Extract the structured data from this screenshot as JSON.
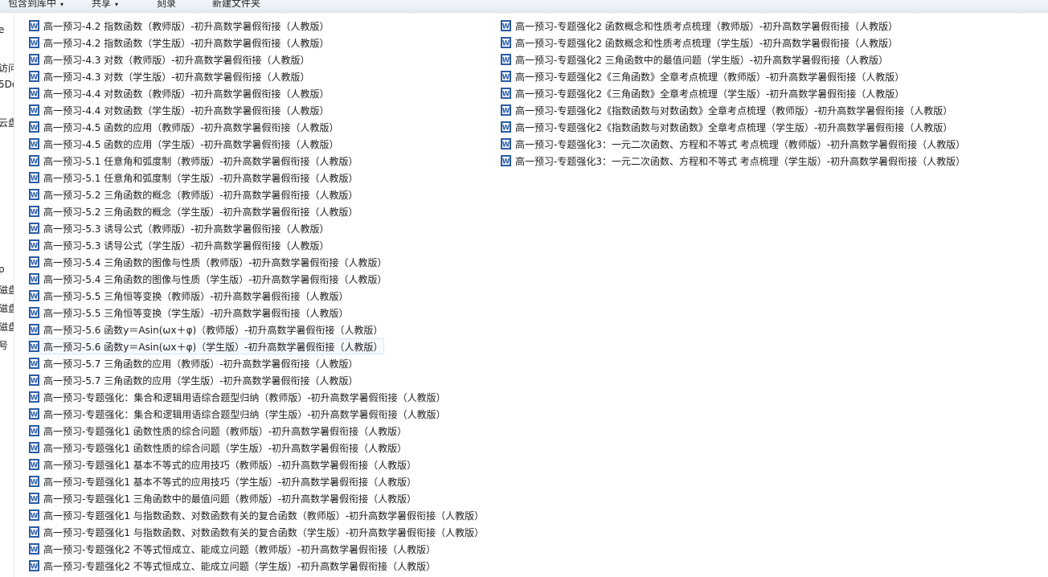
{
  "toolbar": {
    "items": [
      {
        "label": "包含到库中",
        "arrow": "▾"
      },
      {
        "label": "共享",
        "arrow": "▾"
      },
      {
        "label": "刻录",
        "arrow": ""
      },
      {
        "label": "新建文件夹",
        "arrow": ""
      }
    ]
  },
  "nav_pane": {
    "labels": [
      "e",
      "访问",
      "5Do",
      "云盘",
      "p",
      "磁盘",
      "磁盘",
      "磁盘",
      "号"
    ]
  },
  "file_icon": "word-doc-icon",
  "files_left": [
    "高一预习-4.2 指数函数（教师版）-初升高数学暑假衔接（人教版）",
    "高一预习-4.2 指数函数（学生版）-初升高数学暑假衔接（人教版）",
    "高一预习-4.3 对数（教师版）-初升高数学暑假衔接（人教版）",
    "高一预习-4.3 对数（学生版）-初升高数学暑假衔接（人教版）",
    "高一预习-4.4 对数函数（教师版）-初升高数学暑假衔接（人教版）",
    "高一预习-4.4 对数函数（学生版）-初升高数学暑假衔接（人教版）",
    "高一预习-4.5 函数的应用（教师版）-初升高数学暑假衔接（人教版）",
    "高一预习-4.5 函数的应用（学生版）-初升高数学暑假衔接（人教版）",
    "高一预习-5.1 任意角和弧度制（教师版）-初升高数学暑假衔接（人教版）",
    "高一预习-5.1 任意角和弧度制（学生版）-初升高数学暑假衔接（人教版）",
    "高一预习-5.2  三角函数的概念（教师版）-初升高数学暑假衔接（人教版）",
    "高一预习-5.2  三角函数的概念（学生版）-初升高数学暑假衔接（人教版）",
    "高一预习-5.3 诱导公式（教师版）-初升高数学暑假衔接（人教版）",
    "高一预习-5.3 诱导公式（学生版）-初升高数学暑假衔接（人教版）",
    "高一预习-5.4  三角函数的图像与性质（教师版）-初升高数学暑假衔接（人教版）",
    "高一预习-5.4  三角函数的图像与性质（学生版）-初升高数学暑假衔接（人教版）",
    "高一预习-5.5  三角恒等变换（教师版）-初升高数学暑假衔接（人教版）",
    "高一预习-5.5  三角恒等变换（学生版）-初升高数学暑假衔接（人教版）",
    "高一预习-5.6 函数y＝Asin(ωx＋φ)（教师版）-初升高数学暑假衔接（人教版）",
    "高一预习-5.6 函数y＝Asin(ωx＋φ)（学生版）-初升高数学暑假衔接（人教版）",
    "高一预习-5.7 三角函数的应用（教师版）-初升高数学暑假衔接（人教版）",
    "高一预习-5.7 三角函数的应用（学生版）-初升高数学暑假衔接（人教版）",
    "高一预习-专题强化：集合和逻辑用语综合题型归纳（教师版）-初升高数学暑假衔接（人教版）",
    "高一预习-专题强化：集合和逻辑用语综合题型归纳（学生版）-初升高数学暑假衔接（人教版）",
    "高一预习-专题强化1 函数性质的综合问题（教师版）-初升高数学暑假衔接（人教版）",
    "高一预习-专题强化1 函数性质的综合问题（学生版）-初升高数学暑假衔接（人教版）",
    "高一预习-专题强化1 基本不等式的应用技巧（教师版）-初升高数学暑假衔接（人教版）",
    "高一预习-专题强化1 基本不等式的应用技巧（学生版）-初升高数学暑假衔接（人教版）",
    "高一预习-专题强化1 三角函数中的最值问题（教师版）-初升高数学暑假衔接（人教版）",
    "高一预习-专题强化1 与指数函数、对数函数有关的复合函数（教师版）-初升高数学暑假衔接（人教版）",
    "高一预习-专题强化1 与指数函数、对数函数有关的复合函数（学生版）-初升高数学暑假衔接（人教版）",
    "高一预习-专题强化2 不等式恒成立、能成立问题（教师版）-初升高数学暑假衔接（人教版）",
    "高一预习-专题强化2 不等式恒成立、能成立问题（学生版）-初升高数学暑假衔接（人教版）"
  ],
  "files_right": [
    "高一预习-专题强化2 函数概念和性质考点梳理（教师版）-初升高数学暑假衔接（人教版）",
    "高一预习-专题强化2 函数概念和性质考点梳理（学生版）-初升高数学暑假衔接（人教版）",
    "高一预习-专题强化2 三角函数中的最值问题（学生版）-初升高数学暑假衔接（人教版）",
    "高一预习-专题强化2《三角函数》全章考点梳理（教师版）-初升高数学暑假衔接（人教版）",
    "高一预习-专题强化2《三角函数》全章考点梳理（学生版）-初升高数学暑假衔接（人教版）",
    "高一预习-专题强化2《指数函数与对数函数》全章考点梳理（教师版）-初升高数学暑假衔接（人教版）",
    "高一预习-专题强化2《指数函数与对数函数》全章考点梳理（学生版）-初升高数学暑假衔接（人教版）",
    "高一预习-专题强化3：一元二次函数、方程和不等式 考点梳理（教师版）-初升高数学暑假衔接（人教版）",
    "高一预习-专题强化3：一元二次函数、方程和不等式 考点梳理（学生版）-初升高数学暑假衔接（人教版）"
  ]
}
